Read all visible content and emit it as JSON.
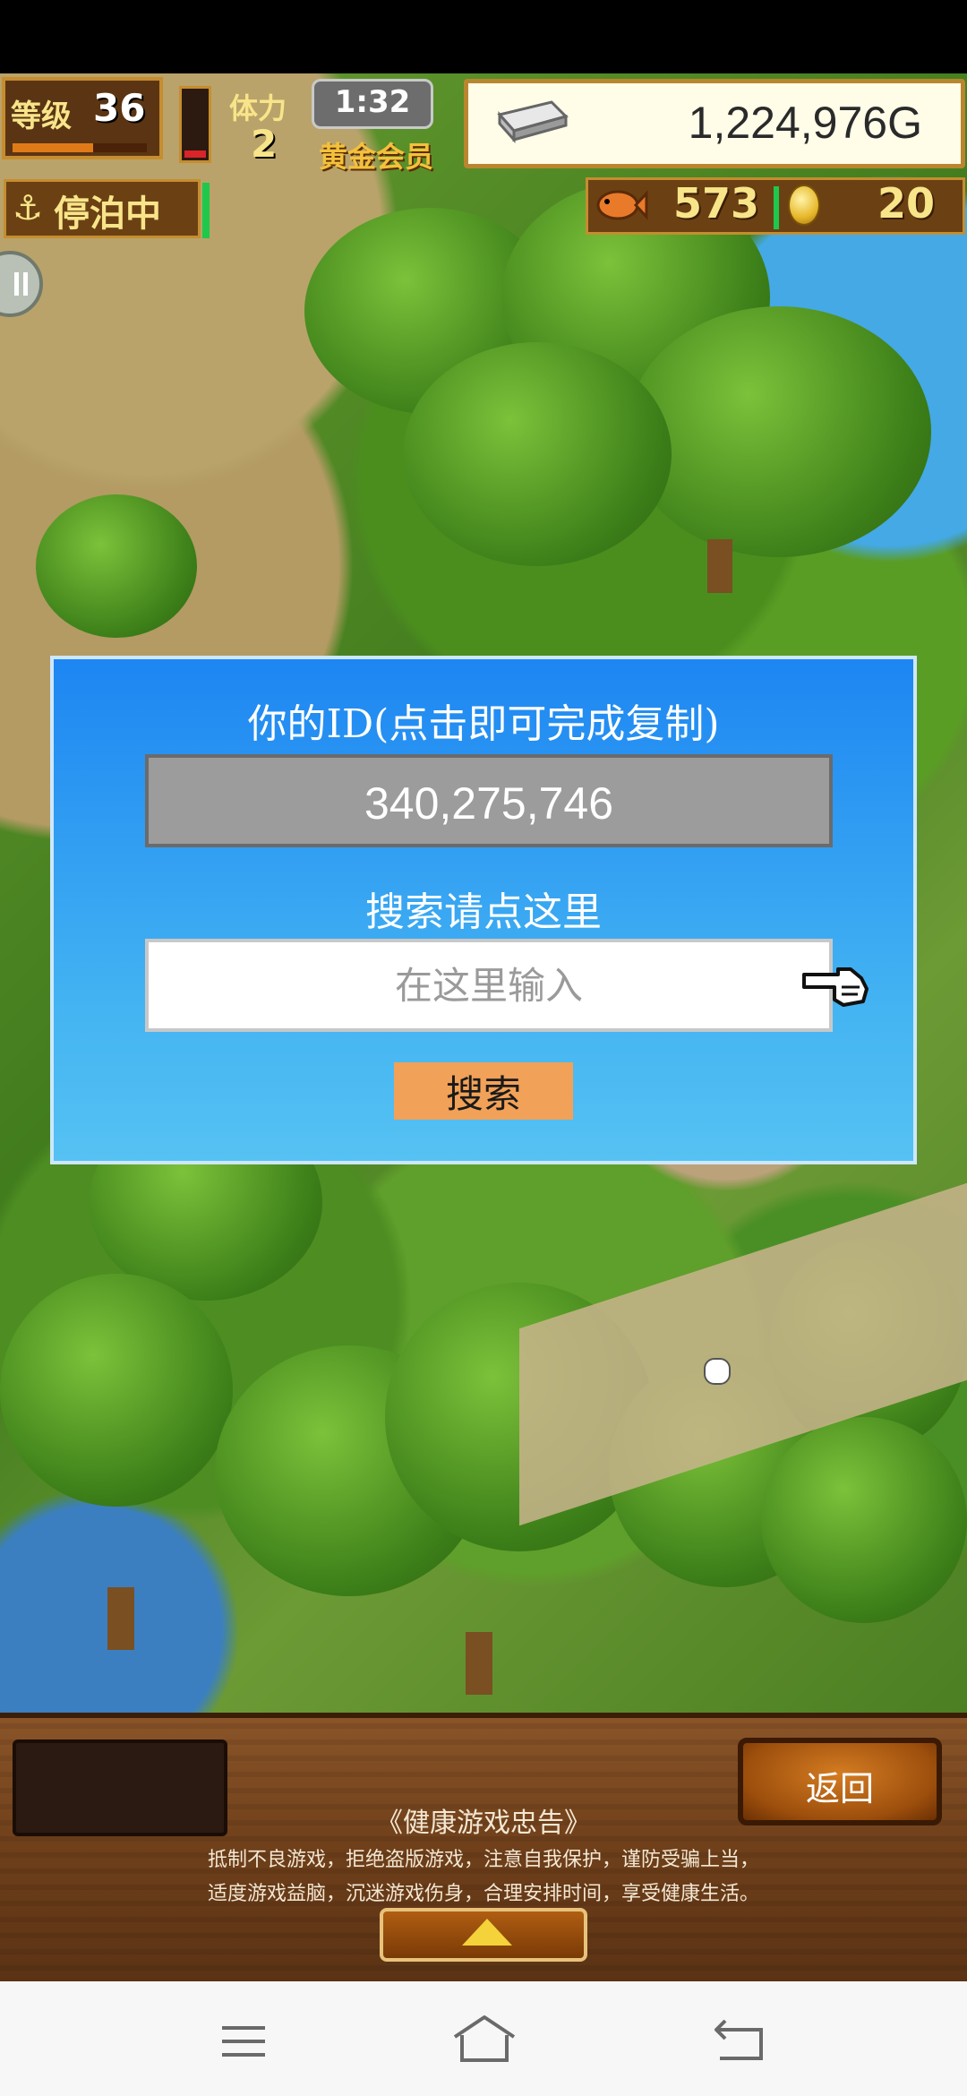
{
  "hud": {
    "level_label": "等级",
    "level_value": "36",
    "xp_progress": 0.6,
    "stamina_label": "体力",
    "stamina_value": "2",
    "stamina_gauge_level": 0.1,
    "time": "1:32",
    "membership": "黄金会员",
    "money": "1,224,976G",
    "status": "停泊中",
    "fish_count": "573",
    "coin_count": "20"
  },
  "dialog": {
    "id_title": "你的ID(点击即可完成复制)",
    "id_value": "340,275,746",
    "search_title": "搜索请点这里",
    "search_placeholder": "在这里输入",
    "search_value": "",
    "search_button": "搜索"
  },
  "bottom": {
    "back_button": "返回",
    "health_title": "《健康游戏忠告》",
    "health_line1": "抵制不良游戏，拒绝盗版游戏，注意自我保护，谨防受骗上当，",
    "health_line2": "适度游戏益脑，沉迷游戏伤身，合理安排时间，享受健康生活。"
  },
  "colors": {
    "dialog_bg": "#1d86f2",
    "search_button_bg": "#f1a158",
    "hud_text": "#f8e58a",
    "navbar_bg": "#f7f7f7"
  },
  "icons": {
    "anchor": "⚓"
  }
}
